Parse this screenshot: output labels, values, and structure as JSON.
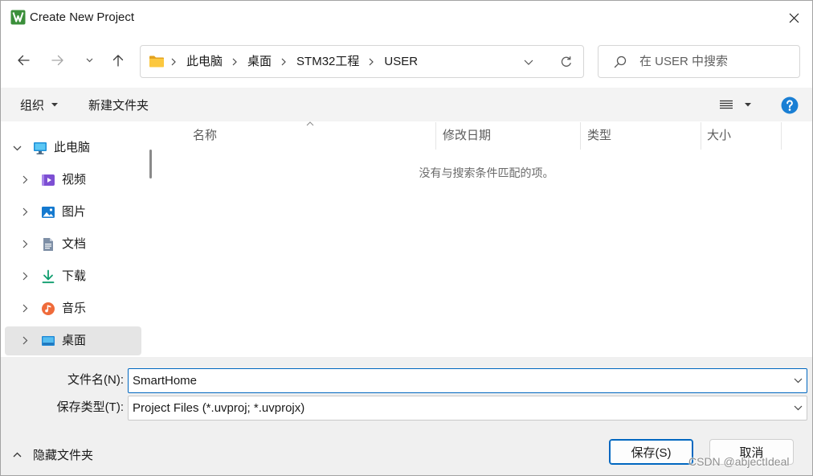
{
  "window": {
    "title": "Create New Project",
    "app_icon": "keil-uvision-icon",
    "close_icon": "close-icon"
  },
  "navigation": {
    "back_icon": "arrow-left-icon",
    "forward_icon": "arrow-right-icon",
    "forward_enabled": false,
    "recent_locations_icon": "chevron-down-icon",
    "up_icon": "arrow-up-icon",
    "location_icon": "folder-icon",
    "breadcrumb": [
      "此电脑",
      "桌面",
      "STM32工程",
      "USER"
    ],
    "address_dropdown_icon": "chevron-down-icon",
    "refresh_icon": "refresh-icon",
    "search_icon": "search-icon",
    "search_placeholder": "在 USER 中搜索"
  },
  "toolbar": {
    "organize_label": "组织",
    "new_folder_label": "新建文件夹",
    "view_icon": "list-view-icon",
    "help_icon": "help-icon"
  },
  "sidebar": {
    "items": [
      {
        "label": "此电脑",
        "icon": "monitor-icon",
        "expanded": true,
        "selected": false
      },
      {
        "label": "视频",
        "icon": "video-icon",
        "expanded": false,
        "selected": false
      },
      {
        "label": "图片",
        "icon": "picture-icon",
        "expanded": false,
        "selected": false
      },
      {
        "label": "文档",
        "icon": "document-icon",
        "expanded": false,
        "selected": false
      },
      {
        "label": "下载",
        "icon": "download-icon",
        "expanded": false,
        "selected": false
      },
      {
        "label": "音乐",
        "icon": "music-icon",
        "expanded": false,
        "selected": false
      },
      {
        "label": "桌面",
        "icon": "desktop-icon",
        "expanded": false,
        "selected": true
      }
    ]
  },
  "file_list": {
    "columns": [
      {
        "label": "名称",
        "sort_icon": "chevron-up-icon"
      },
      {
        "label": "修改日期"
      },
      {
        "label": "类型"
      },
      {
        "label": "大小"
      }
    ],
    "items": [],
    "empty_message": "没有与搜索条件匹配的项。"
  },
  "form": {
    "file_name_label": "文件名(N):",
    "file_name_value": "SmartHome",
    "save_type_label": "保存类型(T):",
    "save_type_value": "Project Files (*.uvproj; *.uvprojx)"
  },
  "footer": {
    "hide_folders_icon": "chevron-up-icon",
    "hide_folders_label": "隐藏文件夹",
    "save_label": "保存(S)",
    "cancel_label": "取消"
  },
  "watermark": "CSDN @abjectIdeal",
  "colors": {
    "accent": "#0067c0",
    "selected_item": "#e5e5e5",
    "help_icon": "#1a7fd4",
    "toolbar_background": "#f3f3f3",
    "footer_background": "#f0f0f0"
  }
}
